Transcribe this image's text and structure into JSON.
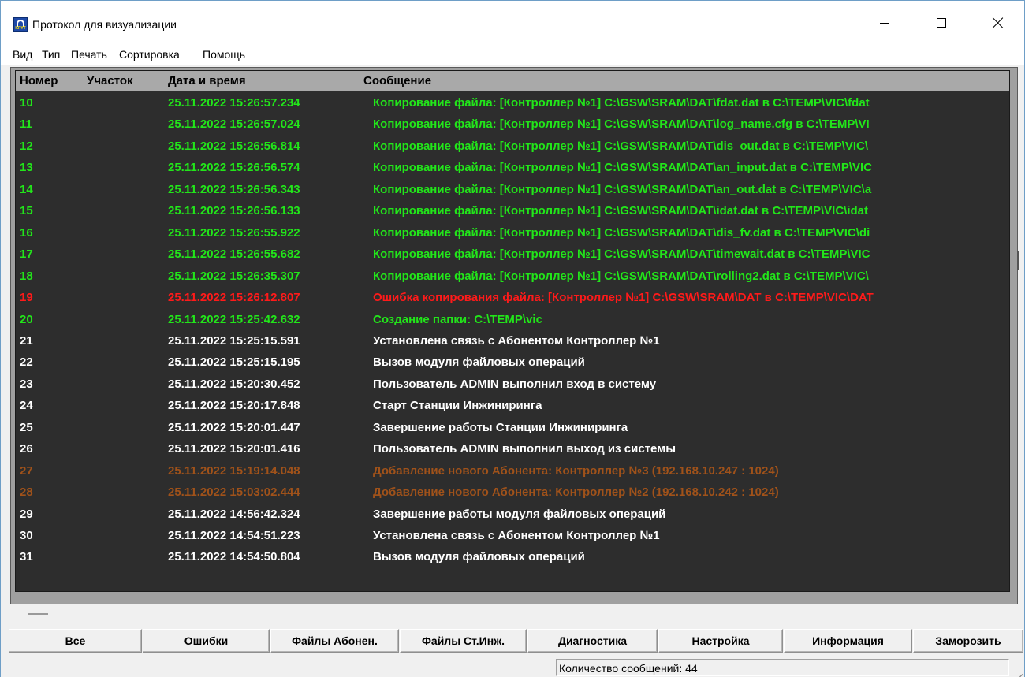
{
  "window": {
    "title": "Протокол для визуализации",
    "icon": "kpyt-logo-icon",
    "icon_text": "KPYT"
  },
  "menu": [
    "Вид",
    "Тип",
    "Печать",
    "Сортировка",
    "Помощь"
  ],
  "table": {
    "headers": [
      "Номер",
      "Участок",
      "Дата и время",
      "Сообщение"
    ],
    "rows": [
      {
        "num": "10",
        "date": "25.11.2022  15:26:57.234",
        "msg": "Копирование файла: [Контроллер №1] C:\\GSW\\SRAM\\DAT\\fdat.dat в C:\\TEMP\\VIC\\fdat",
        "color": "green"
      },
      {
        "num": "11",
        "date": "25.11.2022  15:26:57.024",
        "msg": "Копирование файла: [Контроллер №1] C:\\GSW\\SRAM\\DAT\\log_name.cfg в C:\\TEMP\\VI",
        "color": "green"
      },
      {
        "num": "12",
        "date": "25.11.2022  15:26:56.814",
        "msg": "Копирование файла: [Контроллер №1] C:\\GSW\\SRAM\\DAT\\dis_out.dat в C:\\TEMP\\VIC\\",
        "color": "green"
      },
      {
        "num": "13",
        "date": "25.11.2022  15:26:56.574",
        "msg": "Копирование файла: [Контроллер №1] C:\\GSW\\SRAM\\DAT\\an_input.dat в C:\\TEMP\\VIC",
        "color": "green"
      },
      {
        "num": "14",
        "date": "25.11.2022  15:26:56.343",
        "msg": "Копирование файла: [Контроллер №1] C:\\GSW\\SRAM\\DAT\\an_out.dat в C:\\TEMP\\VIC\\a",
        "color": "green"
      },
      {
        "num": "15",
        "date": "25.11.2022  15:26:56.133",
        "msg": "Копирование файла: [Контроллер №1] C:\\GSW\\SRAM\\DAT\\idat.dat в C:\\TEMP\\VIC\\idat",
        "color": "green"
      },
      {
        "num": "16",
        "date": "25.11.2022  15:26:55.922",
        "msg": "Копирование файла: [Контроллер №1] C:\\GSW\\SRAM\\DAT\\dis_fv.dat в C:\\TEMP\\VIC\\di",
        "color": "green"
      },
      {
        "num": "17",
        "date": "25.11.2022  15:26:55.682",
        "msg": "Копирование файла: [Контроллер №1] C:\\GSW\\SRAM\\DAT\\timewait.dat в C:\\TEMP\\VIC",
        "color": "green"
      },
      {
        "num": "18",
        "date": "25.11.2022  15:26:35.307",
        "msg": "Копирование файла: [Контроллер №1] C:\\GSW\\SRAM\\DAT\\rolling2.dat в C:\\TEMP\\VIC\\",
        "color": "green"
      },
      {
        "num": "19",
        "date": "25.11.2022  15:26:12.807",
        "msg": "Ошибка копирования файла: [Контроллер №1] C:\\GSW\\SRAM\\DAT в C:\\TEMP\\VIC\\DAT",
        "color": "red"
      },
      {
        "num": "20",
        "date": "25.11.2022  15:25:42.632",
        "msg": "Создание папки: C:\\TEMP\\vic",
        "color": "green"
      },
      {
        "num": "21",
        "date": "25.11.2022  15:25:15.591",
        "msg": "Установлена связь с Абонентом Контроллер №1",
        "color": "white"
      },
      {
        "num": "22",
        "date": "25.11.2022  15:25:15.195",
        "msg": "Вызов модуля файловых операций",
        "color": "white"
      },
      {
        "num": "23",
        "date": "25.11.2022  15:20:30.452",
        "msg": "Пользователь ADMIN выполнил вход в систему",
        "color": "white"
      },
      {
        "num": "24",
        "date": "25.11.2022  15:20:17.848",
        "msg": "Старт Станции Инжиниринга",
        "color": "white"
      },
      {
        "num": "25",
        "date": "25.11.2022  15:20:01.447",
        "msg": "Завершение работы Станции Инжиниринга",
        "color": "white"
      },
      {
        "num": "26",
        "date": "25.11.2022  15:20:01.416",
        "msg": "Пользователь ADMIN выполнил выход из системы",
        "color": "white"
      },
      {
        "num": "27",
        "date": "25.11.2022  15:19:14.048",
        "msg": "Добавление нового Абонента: Контроллер №3 (192.168.10.247 : 1024)",
        "color": "brown"
      },
      {
        "num": "28",
        "date": "25.11.2022  15:03:02.444",
        "msg": "Добавление нового Абонента: Контроллер №2 (192.168.10.242 : 1024)",
        "color": "brown"
      },
      {
        "num": "29",
        "date": "25.11.2022  14:56:42.324",
        "msg": "Завершение работы модуля файловых операций",
        "color": "white"
      },
      {
        "num": "30",
        "date": "25.11.2022  14:54:51.223",
        "msg": "Установлена связь с Абонентом Контроллер №1",
        "color": "white"
      },
      {
        "num": "31",
        "date": "25.11.2022  14:54:50.804",
        "msg": "Вызов модуля файловых операций",
        "color": "white"
      }
    ]
  },
  "buttons": [
    "Все",
    "Ошибки",
    "Файлы Абонен.",
    "Файлы Ст.Инж.",
    "Диагностика",
    "Настройка",
    "Информация",
    "Заморозить"
  ],
  "status": {
    "count_label": "Количество сообщений: 44"
  },
  "colors": {
    "green": "#22e61a",
    "red": "#ff1a1a",
    "white": "#ffffff",
    "brown": "#a0521a",
    "log_background": "#2d2d2d"
  }
}
